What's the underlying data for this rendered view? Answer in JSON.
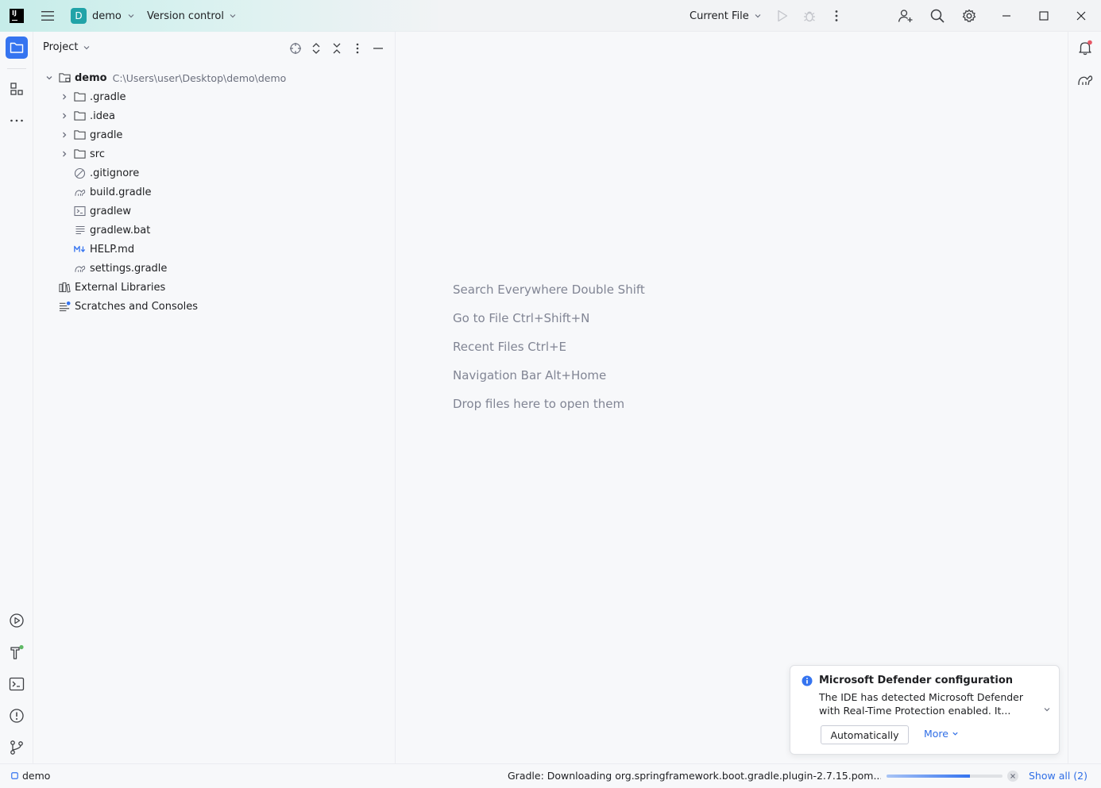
{
  "titlebar": {
    "logo_text": "IJ",
    "project_badge": "D",
    "project_name": "demo",
    "vcs_label": "Version control",
    "run_config": "Current File"
  },
  "project_panel": {
    "title": "Project",
    "tree": [
      {
        "label": "demo",
        "path": "C:\\Users\\user\\Desktop\\demo\\demo",
        "icon": "module-folder-icon",
        "level": 0,
        "expandable": true,
        "expanded": true
      },
      {
        "label": ".gradle",
        "icon": "folder-icon",
        "level": 1,
        "expandable": true
      },
      {
        "label": ".idea",
        "icon": "folder-icon",
        "level": 1,
        "expandable": true
      },
      {
        "label": "gradle",
        "icon": "folder-icon",
        "level": 1,
        "expandable": true
      },
      {
        "label": "src",
        "icon": "folder-icon",
        "level": 1,
        "expandable": true
      },
      {
        "label": ".gitignore",
        "icon": "ignore-file-icon",
        "level": 1,
        "expandable": false
      },
      {
        "label": "build.gradle",
        "icon": "gradle-file-icon",
        "level": 1,
        "expandable": false
      },
      {
        "label": "gradlew",
        "icon": "shell-script-icon",
        "level": 1,
        "expandable": false
      },
      {
        "label": "gradlew.bat",
        "icon": "text-file-icon",
        "level": 1,
        "expandable": false
      },
      {
        "label": "HELP.md",
        "icon": "markdown-file-icon",
        "level": 1,
        "expandable": false
      },
      {
        "label": "settings.gradle",
        "icon": "gradle-file-icon",
        "level": 1,
        "expandable": false
      },
      {
        "label": "External Libraries",
        "icon": "libraries-icon",
        "level": 0,
        "expandable": true
      },
      {
        "label": "Scratches and Consoles",
        "icon": "scratches-icon",
        "level": 0,
        "expandable": true
      }
    ]
  },
  "editor": {
    "hints": [
      "Search Everywhere Double Shift",
      "Go to File Ctrl+Shift+N",
      "Recent Files Ctrl+E",
      "Navigation Bar Alt+Home",
      "Drop files here to open them"
    ]
  },
  "notification": {
    "title": "Microsoft Defender configuration",
    "body": "The IDE has detected Microsoft Defender with Real-Time Protection enabled. It...",
    "button_label": "Automatically",
    "more_label": "More"
  },
  "statusbar": {
    "project": "demo",
    "progress_text": "Gradle: Downloading org.springframework.boot.gradle.plugin-2.7.15.pom...",
    "progress_fraction": 0.72,
    "show_all": "Show all (2)"
  },
  "colors": {
    "accent": "#3574f0",
    "project_badge": "#21a3a8",
    "notification_dot": "#e55765",
    "build_ok": "#5fb865"
  }
}
